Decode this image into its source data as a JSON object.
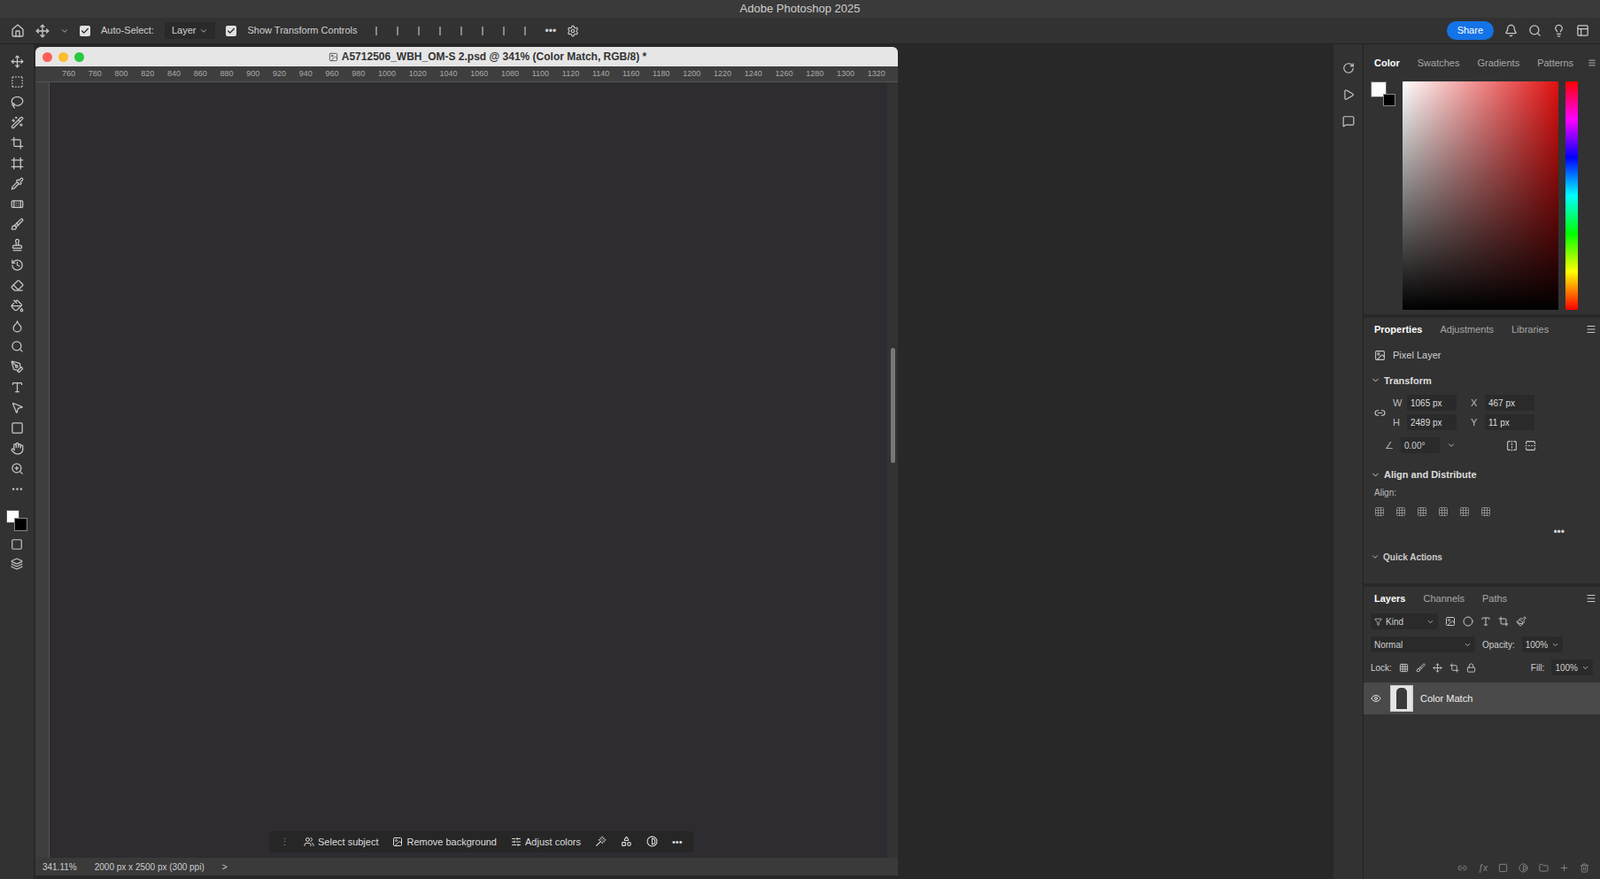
{
  "app": {
    "title": "Adobe Photoshop 2025"
  },
  "options_bar": {
    "auto_select": {
      "label": "Auto-Select:",
      "checked": true,
      "dropdown": "Layer"
    },
    "show_transform_controls": {
      "label": "Show Transform Controls",
      "checked": true
    },
    "more": "•••",
    "share": "Share"
  },
  "document": {
    "title": "A5712506_WBH_OM-S 2.psd @ 341% (Color Match, RGB/8) *",
    "ruler_ticks": [
      "760",
      "780",
      "800",
      "820",
      "840",
      "860",
      "880",
      "900",
      "920",
      "940",
      "960",
      "980",
      "1000",
      "1020",
      "1040",
      "1060",
      "1080",
      "1100",
      "1120",
      "1140",
      "1160",
      "1180",
      "1200",
      "1220",
      "1240",
      "1260",
      "1280",
      "1300",
      "1320"
    ],
    "status": {
      "zoom": "341.11%",
      "info": "2000 px x 2500 px (300 ppi)",
      "arrow": ">"
    },
    "task_bar": {
      "items": [
        "Select subject",
        "Remove background",
        "Adjust colors"
      ],
      "more": "•••"
    }
  },
  "color_panel": {
    "tabs": [
      {
        "label": "Color",
        "selected": true
      },
      {
        "label": "Swatches",
        "selected": false
      },
      {
        "label": "Gradients",
        "selected": false
      },
      {
        "label": "Patterns",
        "selected": false
      }
    ]
  },
  "properties_panel": {
    "tabs": [
      {
        "label": "Properties",
        "selected": true
      },
      {
        "label": "Adjustments",
        "selected": false
      },
      {
        "label": "Libraries",
        "selected": false
      }
    ],
    "kind": "Pixel Layer",
    "transform": {
      "title": "Transform",
      "expanded": true,
      "w": "1065 px",
      "h": "2489 px",
      "x": "467 px",
      "y": "11 px",
      "angle": "0.00°",
      "labels": {
        "w": "W",
        "h": "H",
        "x": "X",
        "y": "Y"
      }
    },
    "align": {
      "title": "Align and Distribute",
      "expanded": true,
      "label": "Align:",
      "more": "•••"
    },
    "quick_actions": {
      "title": "Quick Actions"
    }
  },
  "layers_panel": {
    "tabs": [
      {
        "label": "Layers",
        "selected": true
      },
      {
        "label": "Channels",
        "selected": false
      },
      {
        "label": "Paths",
        "selected": false
      }
    ],
    "filter": "Kind",
    "blend_mode": "Normal",
    "opacity_label": "Opacity:",
    "opacity": "100%",
    "lock_label": "Lock:",
    "fill_label": "Fill:",
    "fill": "100%",
    "layers": [
      {
        "name": "Color Match",
        "visible": true,
        "selected": true
      }
    ]
  }
}
